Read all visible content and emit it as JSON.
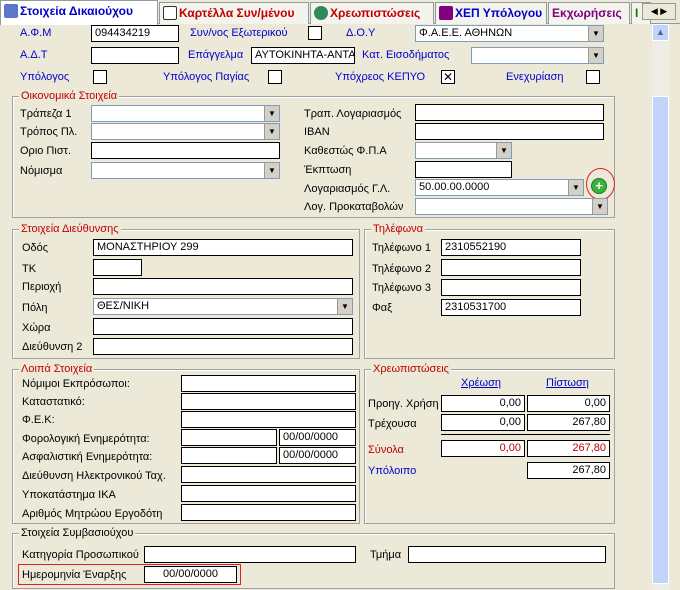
{
  "tabs": [
    {
      "label": "Στοιχεία Δικαιούχου",
      "color": "#0000CC",
      "icon": "people-icon"
    },
    {
      "label": "Καρτέλλα Συν/μένου",
      "color": "#C00000",
      "icon": "card-icon"
    },
    {
      "label": "Χρεωπιστώσεις",
      "color": "#C00000",
      "icon": "globe-icon"
    },
    {
      "label": "ΧΕΠ Υπόλογου",
      "color": "#0000CC",
      "icon": "book-icon"
    },
    {
      "label": "Εκχωρήσεις",
      "color": "#800080",
      "icon": ""
    },
    {
      "label": "Ι",
      "color": "#008000",
      "icon": ""
    }
  ],
  "top": {
    "afm_label": "Α.Φ.Μ",
    "afm_value": "094434219",
    "syn_ext_label": "Συν/νος Εξωτερικού",
    "doy_label": "Δ.Ο.Υ",
    "doy_value": "Φ.Α.Ε.Ε. ΑΘΗΝΩΝ",
    "adt_label": "Α.Δ.Τ",
    "adt_value": "",
    "epaggelma_label": "Επάγγελμα",
    "epaggelma_value": "ΑΥΤΟΚΙΝΗΤΑ-ΑΝΤΑΛΛ",
    "kat_label": "Κατ. Εισοδήματος",
    "kat_value": "",
    "ypologos_label": "Υπόλογος",
    "ypologos_pagias_label": "Υπόλογος Παγίας",
    "kepyo_label": "Υπόχρεος ΚΕΠΥΟ",
    "enexyriasi_label": "Ενεχυρίαση"
  },
  "oikonomika": {
    "title": "Οικονομικά Στοιχεία",
    "trapeza_label": "Τράπεζα 1",
    "tropos_label": "Τρόπος Πλ.",
    "orio_label": "Οριο Πιστ.",
    "nomisma_label": "Νόμισμα",
    "trap_log_label": "Τραπ. Λογαριασμός",
    "iban_label": "IBAN",
    "fpa_label": "Καθεστώς Φ.Π.Α",
    "ekptosi_label": "Έκπτωση",
    "log_gl_label": "Λογαριασμός Γ.Λ.",
    "log_gl_value": "50.00.00.0000",
    "log_prok_label": "Λογ. Προκαταβολών"
  },
  "dieythynsi": {
    "title": "Στοιχεία Διεύθυνσης",
    "odos_label": "Οδός",
    "odos_value": "ΜΟΝΑΣΤΗΡΙΟΥ 299",
    "tk_label": "ΤΚ",
    "tk_value": "",
    "perioxi_label": "Περιοχή",
    "poli_label": "Πόλη",
    "poli_value": "ΘΕΣ/ΝΙΚΗ",
    "xora_label": "Χώρα",
    "dieyth2_label": "Διεύθυνση 2"
  },
  "tilefona": {
    "title": "Τηλέφωνα",
    "t1_label": "Τηλέφωνο 1",
    "t1_value": "2310552190",
    "t2_label": "Τηλέφωνο 2",
    "t2_value": "",
    "t3_label": "Τηλέφωνο 3",
    "t3_value": "",
    "fax_label": "Φαξ",
    "fax_value": "2310531700"
  },
  "loipa": {
    "title": "Λοιπά Στοιχεία",
    "nomimoi_label": "Νόμιμοι Εκπρόσωποι:",
    "katastatiko_label": "Καταστατικό:",
    "fek_label": "Φ.Ε.Κ:",
    "forologiki_label": "Φορολογική Ενημερότητα:",
    "forologiki_date": "00/00/0000",
    "asfalistiki_label": "Ασφαλιστική Ενημερότητα:",
    "asfalistiki_date": "00/00/0000",
    "email_label": "Διεύθυνση Ηλεκτρονικού Ταχ.",
    "ika_label": "Υποκατάστημα ΙΚΑ",
    "mitroo_label": "Αριθμός Μητρώου Εργοδότη"
  },
  "xreopistoseis": {
    "title": "Χρεωπιστώσεις",
    "xreosi_header": "Χρέωση",
    "pistosi_header": "Πίστωση",
    "rows": [
      {
        "label": "Προηγ. Χρήση",
        "xreosi": "0,00",
        "pistosi": "0,00"
      },
      {
        "label": "Τρέχουσα",
        "xreosi": "0,00",
        "pistosi": "267,80"
      }
    ],
    "synola_label": "Σύνολα",
    "synola_xreosi": "0,00",
    "synola_pistosi": "267,80",
    "ypoloipo_label": "Υπόλοιπο",
    "ypoloipo_value": "267,80"
  },
  "symvasiouxou": {
    "title": "Στοιχεία Συμβασιούχου",
    "katigoria_label": "Κατηγορία Προσωπικού",
    "tmima_label": "Τμήμα",
    "enarxi_label": "Ημερομηνία Έναρξης",
    "enarxi_value": "00/00/0000"
  },
  "colors": {
    "frame_title": "#C00000",
    "label_blue": "#0000CC",
    "highlight": "#E02020",
    "add_button": "#3CB03C"
  }
}
